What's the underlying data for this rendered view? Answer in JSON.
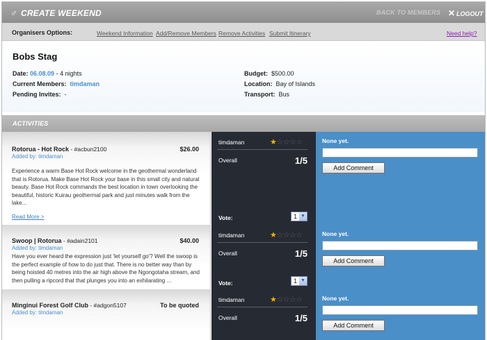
{
  "header": {
    "title": "CREATE WEEKEND",
    "back_label": "BACK TO MEMBERS",
    "logout_label": "LOGOUT"
  },
  "options": {
    "label": "Organisers Options:",
    "links": [
      "Weekend Information",
      "Add/Remove Members",
      "Remove Activities",
      "Submit Itinerary"
    ],
    "help": "Need help?"
  },
  "summary": {
    "title": "Bobs Stag",
    "date_label": "Date:",
    "date_value": "06.08.09",
    "date_suffix": " - 4 nights",
    "members_label": "Current Members:",
    "members_value": "timdaman",
    "pending_label": "Pending Invites:",
    "pending_value": "-",
    "budget_label": "Budget:",
    "budget_value": "$500.00",
    "location_label": "Location:",
    "location_value": "Bay of Islands",
    "transport_label": "Transport:",
    "transport_value": "Bus"
  },
  "activities_header": "ACTIVITIES",
  "activities": [
    {
      "name": "Rotorua - Hot Rock",
      "code": " - #acbun2100",
      "added_by": "Added by: timdaman",
      "price": "$26.00",
      "description": "Experience a warm Base Hot Rock welcome in the geothermal wonderland that is Rotorua. Make Base Hot Rock your base in this small city and natural beauty. Base Hot Rock commands the best location in town overlooking the beautiful, historic Kuirau geothermal park and just minutes walk from the lake...",
      "read_more": "Read More >",
      "rater": "timdaman",
      "stars": 1,
      "overall_label": "Overall",
      "score": "1/5",
      "vote_label": "Vote:",
      "vote_value": "1",
      "comments": "None yet.",
      "add_comment": "Add Comment"
    },
    {
      "name": "Swoop | Rotorua",
      "code": " - #adain2101",
      "added_by": "Added by: timdaman",
      "price": "$40.00",
      "description": "Have you ever heard the expression just 'let yourself go'? Well the swoop is the perfect example of how to do just that. There is no better way than by being hoisted 40 metres into the air high above the Ngongotaha stream, and then pulling a ripcord that that plunges you into an exhilarating ...",
      "rater": "timdaman",
      "stars": 1,
      "overall_label": "Overall",
      "score": "1/5",
      "vote_label": "Vote:",
      "vote_value": "1",
      "comments": "None yet.",
      "add_comment": "Add Comment"
    },
    {
      "name": "Minginui Forest Golf Club",
      "code": " - #adgon5107",
      "added_by": "Added by: timdaman",
      "price": "To be quoted",
      "rater": "timdaman",
      "stars": 1,
      "overall_label": "Overall",
      "score": "1/5",
      "comments": "None yet.",
      "add_comment": "Add Comment"
    }
  ]
}
